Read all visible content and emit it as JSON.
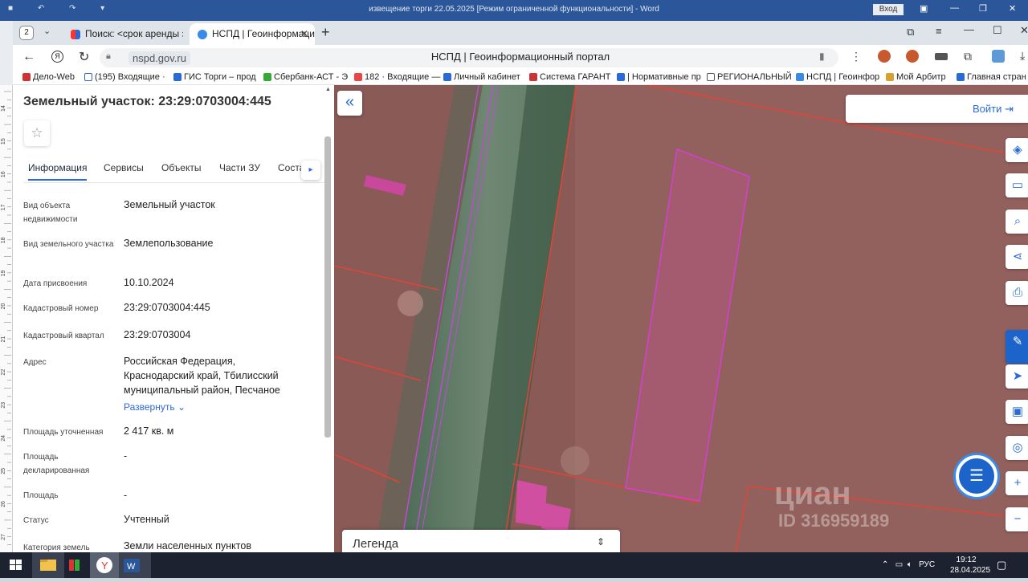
{
  "word": {
    "title": "извещение торги 22.05.2025 [Режим ограниченной функциональности]  -  Word",
    "login": "Вход"
  },
  "browser": {
    "tab_count": "2",
    "tabs": [
      {
        "label": "Поиск: <срок аренды зем",
        "active": false
      },
      {
        "label": "НСПД | Геоинформаци",
        "active": true
      }
    ],
    "url": "nspd.gov.ru",
    "page_title": "НСПД | Геоинформационный портал",
    "bookmarks": [
      "Дело-Web",
      "(195) Входящие ·",
      "ГИС Торги – прод",
      "Сбербанк-АСТ - Э",
      "182 · Входящие —",
      "Личный кабинет",
      "Система ГАРАНТ",
      "| Нормативные пр",
      "РЕГИОНАЛЬНЫЙ",
      "НСПД | Геоинфор",
      "Мой Арбитр",
      "Главная стран"
    ]
  },
  "ruler": {
    "marks": [
      "14",
      "15",
      "16",
      "17",
      "18",
      "19",
      "20",
      "21",
      "22",
      "23",
      "24",
      "25",
      "26",
      "27"
    ]
  },
  "panel": {
    "title": "Земельный участок: 23:29:0703004:445",
    "tabs": [
      "Информация",
      "Сервисы",
      "Объекты",
      "Части ЗУ",
      "Состав"
    ],
    "rows": [
      {
        "label": "Вид объекта недвижимости",
        "value": "Земельный участок"
      },
      {
        "label": "Вид земельного участка",
        "value": "Землепользование"
      },
      {
        "label": "Дата присвоения",
        "value": "10.10.2024"
      },
      {
        "label": "Кадастровый номер",
        "value": "23:29:0703004:445"
      },
      {
        "label": "Кадастровый квартал",
        "value": "23:29:0703004"
      },
      {
        "label": "Адрес",
        "value": "Российская Федерация, Краснодарский край, Тбилисский муниципальный район, Песчаное"
      },
      {
        "label": "Площадь уточненная",
        "value": "2 417 кв. м"
      },
      {
        "label": "Площадь декларированная",
        "value": "-"
      },
      {
        "label": "Площадь",
        "value": "-"
      },
      {
        "label": "Статус",
        "value": "Учтенный"
      },
      {
        "label": "Категория земель",
        "value": "Земли населенных пунктов"
      }
    ],
    "expand_label": "Развернуть"
  },
  "map": {
    "login": "Войти",
    "legend": "Легенда",
    "watermark": "циан",
    "watermark_id": "ID 316959189"
  },
  "taskbar": {
    "lang": "РУС",
    "time": "19:12",
    "date": "28.04.2025"
  }
}
